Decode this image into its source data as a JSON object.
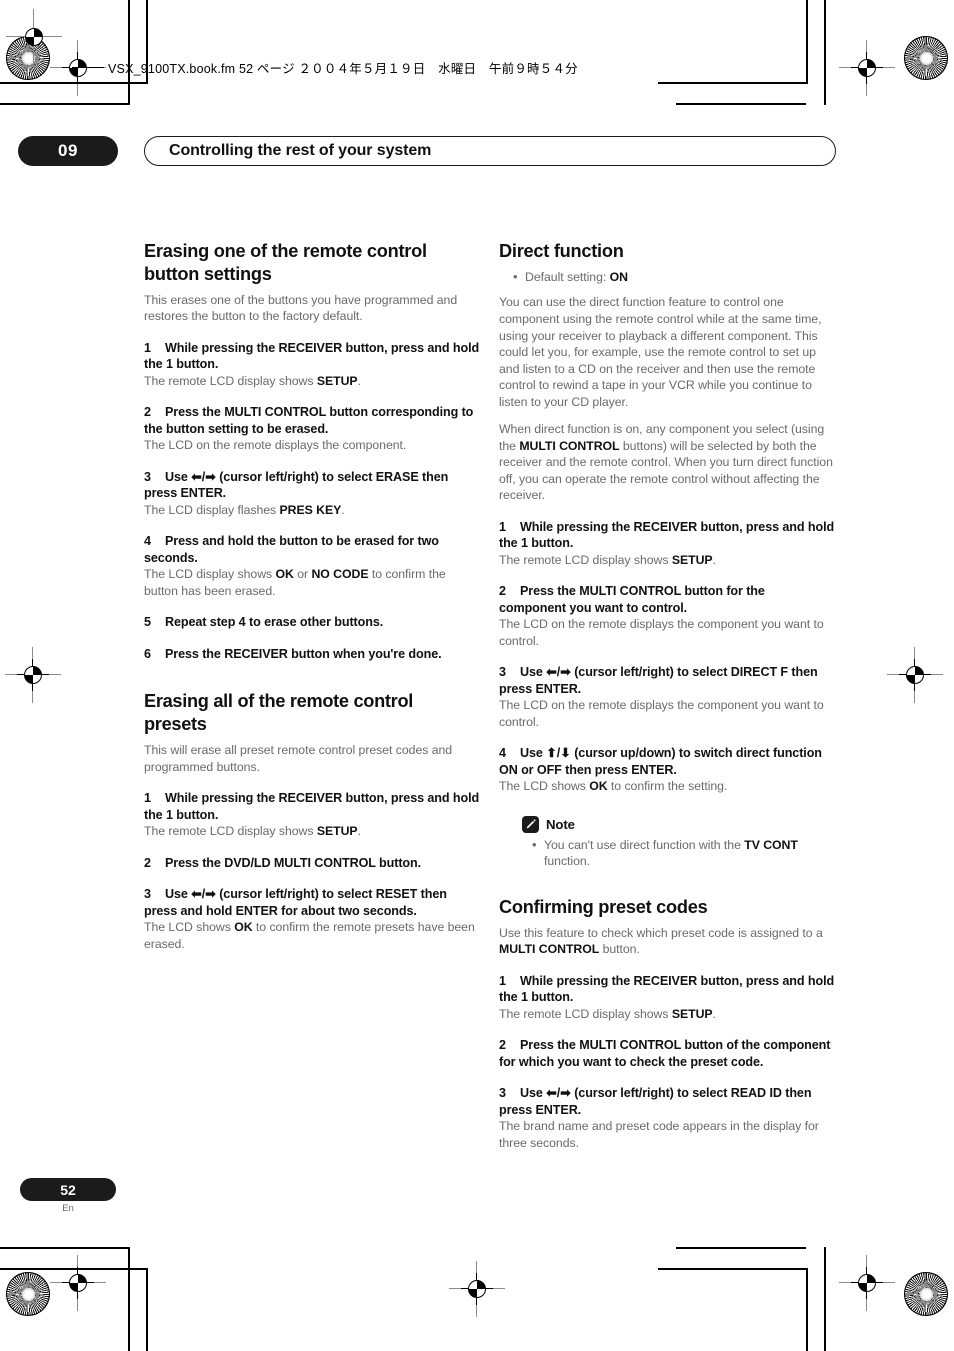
{
  "file_header": {
    "text": "VSX_9100TX.book.fm 52 ページ ２００４年５月１９日　水曜日　午前９時５４分"
  },
  "chapter": {
    "number": "09",
    "title": "Controlling the rest of your system"
  },
  "icons": {
    "note": "pencil-icon"
  },
  "left_column": {
    "section1": {
      "heading": "Erasing one of the remote control button settings",
      "intro": "This erases one of the buttons you have programmed and restores the button to the factory default.",
      "steps": [
        {
          "num": "1",
          "text_a": "While pressing the RECEIVER button, press and hold the 1 button.",
          "result_a": "The remote LCD display shows ",
          "result_b": "SETUP",
          "result_c": "."
        },
        {
          "num": "2",
          "text_a": "Press the MULTI CONTROL button corresponding to the button setting to be erased.",
          "result_a": "The LCD on the remote displays the component."
        },
        {
          "num": "3",
          "label": "Use ",
          "arrows": "⬅/➡",
          "text_a": " (cursor left/right) to select ERASE then press ENTER.",
          "result_a": "The LCD display flashes ",
          "result_b": "PRES KEY",
          "result_c": "."
        },
        {
          "num": "4",
          "text_a": "Press and hold the button to be erased for two seconds.",
          "result_a": "The LCD display shows ",
          "result_b": "OK",
          "result_c": " or ",
          "result_d": "NO CODE",
          "result_e": " to confirm the button has been erased."
        },
        {
          "num": "5",
          "text_a": "Repeat step 4 to erase other buttons."
        },
        {
          "num": "6",
          "text_a": "Press the RECEIVER button when you're done."
        }
      ]
    },
    "section2": {
      "heading": "Erasing all of the remote control presets",
      "intro": "This will erase all preset remote control preset codes and programmed buttons.",
      "steps": [
        {
          "num": "1",
          "text_a": "While pressing the RECEIVER button, press and hold the 1 button.",
          "result_a": "The remote LCD display shows ",
          "result_b": "SETUP",
          "result_c": "."
        },
        {
          "num": "2",
          "text_a": "Press the DVD/LD MULTI CONTROL button."
        },
        {
          "num": "3",
          "label": "Use ",
          "arrows": "⬅/➡",
          "text_a": " (cursor left/right) to select RESET then press and hold ENTER for about two seconds.",
          "result_a": "The LCD shows ",
          "result_b": "OK",
          "result_c": " to confirm the remote presets have been erased."
        }
      ]
    }
  },
  "right_column": {
    "section1": {
      "heading": "Direct function",
      "default_setting_label": "Default setting: ",
      "default_setting_value": "ON",
      "para1": "You can use the direct function feature to control one component using the remote control while at the same time, using your receiver to playback a different component. This could let you, for example, use the remote control to set up and listen to a CD on the receiver and then use the remote control to rewind a tape in your VCR while you continue to listen to your CD player.",
      "para2_a": "When direct function is on, any component you select (using the ",
      "para2_b": "MULTI CONTROL",
      "para2_c": " buttons) will be selected by both the receiver and the remote control. When you turn direct function off, you can operate the remote control without affecting the receiver.",
      "steps": [
        {
          "num": "1",
          "text_a": "While pressing the RECEIVER button, press and hold the 1 button.",
          "result_a": "The remote LCD display shows ",
          "result_b": "SETUP",
          "result_c": "."
        },
        {
          "num": "2",
          "text_a": "Press the MULTI CONTROL button for the component you want to control.",
          "result_a": "The LCD on the remote displays the component you want to control."
        },
        {
          "num": "3",
          "label": "Use ",
          "arrows": "⬅/➡",
          "text_a": " (cursor left/right) to select DIRECT F then press ENTER.",
          "result_a": "The LCD on the remote displays the component you want to control."
        },
        {
          "num": "4",
          "label": "Use ",
          "arrows": "⬆/⬇",
          "text_a": " (cursor up/down) to switch direct function ON or OFF then press ENTER.",
          "result_a": "The LCD shows ",
          "result_b": "OK",
          "result_c": " to confirm the setting."
        }
      ],
      "note": {
        "title": "Note",
        "text_a": "You can't use direct function with the ",
        "text_b": "TV CONT",
        "text_c": " function."
      }
    },
    "section2": {
      "heading": "Confirming preset codes",
      "intro_a": "Use this feature to check which preset code is assigned to a ",
      "intro_b": "MULTI CONTROL",
      "intro_c": " button.",
      "steps": [
        {
          "num": "1",
          "text_a": "While pressing the RECEIVER button, press and hold the 1 button.",
          "result_a": "The remote LCD display shows ",
          "result_b": "SETUP",
          "result_c": "."
        },
        {
          "num": "2",
          "text_a": "Press the MULTI CONTROL button of the component for which you want to check the preset code."
        },
        {
          "num": "3",
          "label": "Use ",
          "arrows": "⬅/➡",
          "text_a": " (cursor left/right) to select READ ID then press ENTER.",
          "result_a": "The brand name and preset code appears in the display for three seconds."
        }
      ]
    }
  },
  "footer": {
    "page_number": "52",
    "language": "En"
  }
}
